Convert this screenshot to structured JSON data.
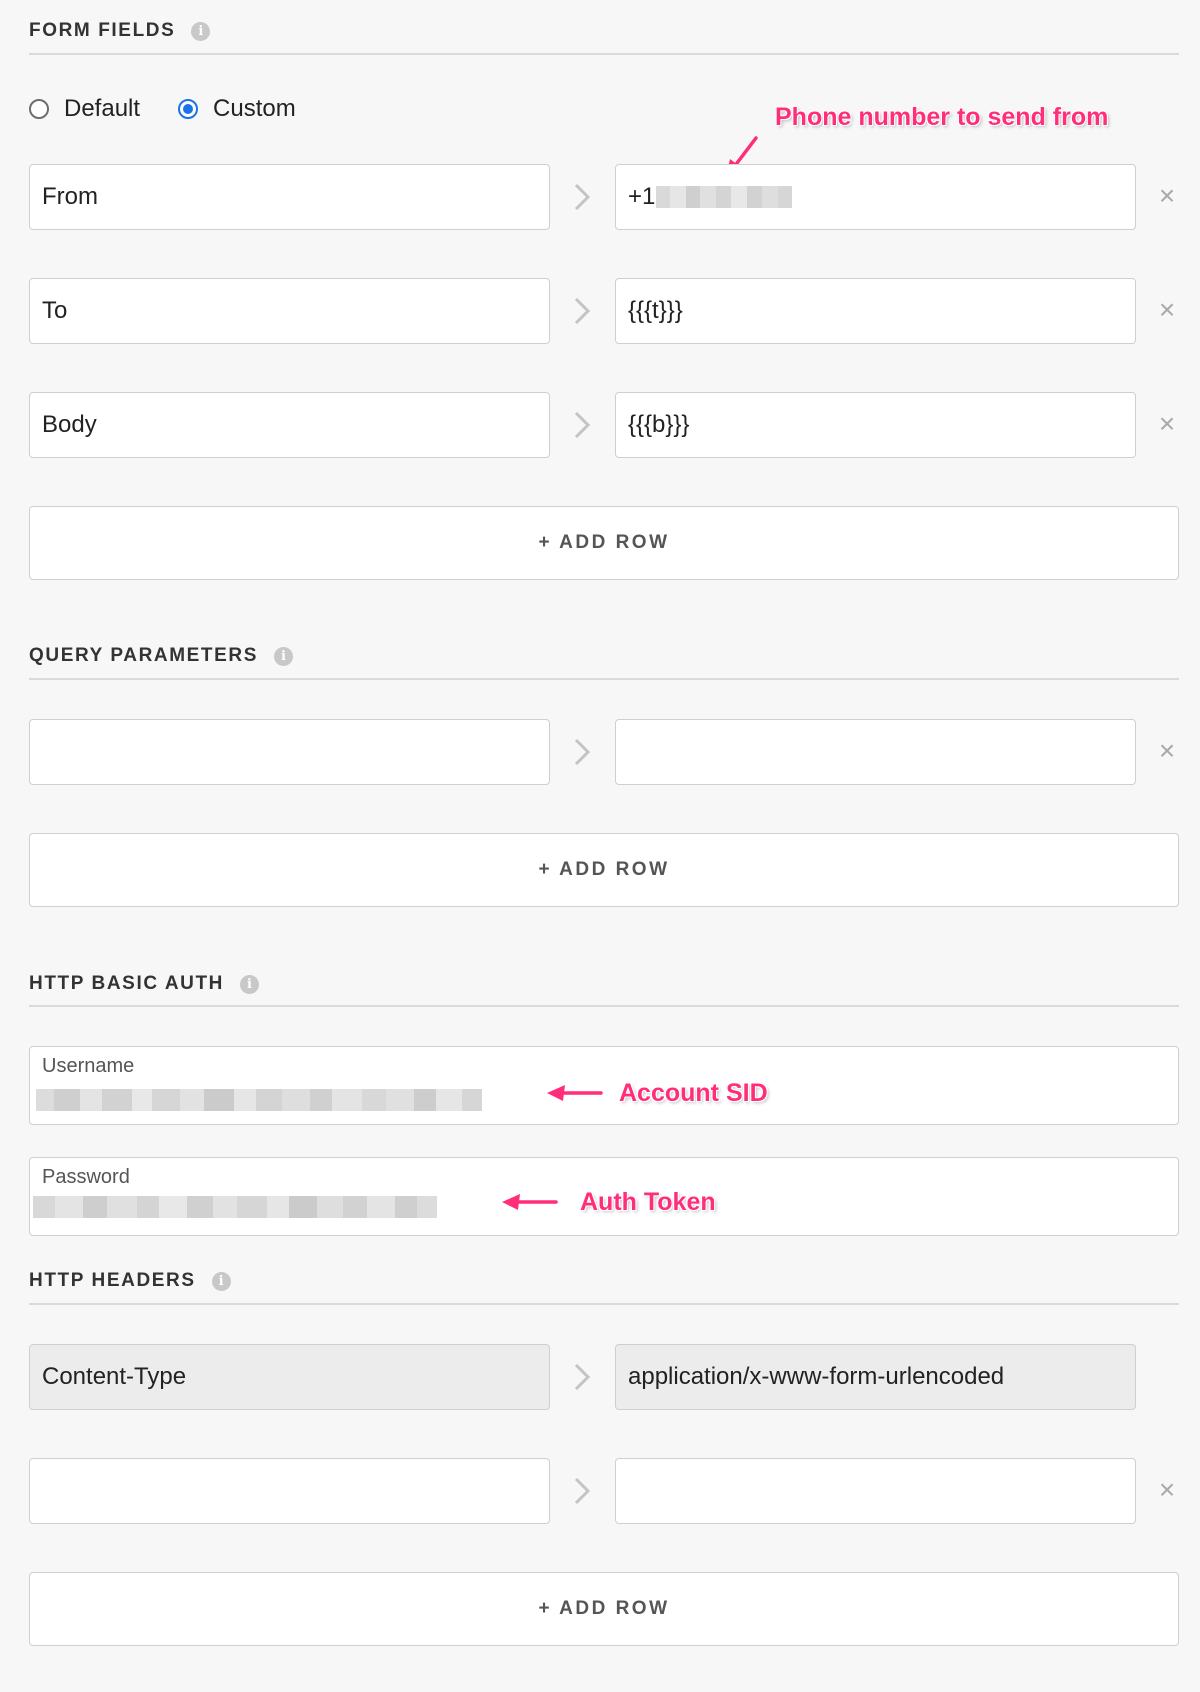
{
  "form_fields": {
    "heading": "FORM FIELDS",
    "info_icon": "info-icon",
    "radio_options": [
      {
        "label": "Default",
        "checked": false
      },
      {
        "label": "Custom",
        "checked": true
      }
    ],
    "rows": [
      {
        "key": "From",
        "value": "+1",
        "value_redacted": true
      },
      {
        "key": "To",
        "value": "{{{t}}}"
      },
      {
        "key": "Body",
        "value": "{{{b}}}"
      }
    ],
    "add_row_label": "+ ADD ROW"
  },
  "query_parameters": {
    "heading": "QUERY PARAMETERS",
    "rows": [
      {
        "key": "",
        "value": ""
      }
    ],
    "add_row_label": "+ ADD ROW"
  },
  "http_basic_auth": {
    "heading": "HTTP BASIC AUTH",
    "username_label": "Username",
    "password_label": "Password"
  },
  "http_headers": {
    "heading": "HTTP HEADERS",
    "rows": [
      {
        "key": "Content-Type",
        "value": "application/x-www-form-urlencoded",
        "readonly": true
      },
      {
        "key": "",
        "value": ""
      }
    ],
    "add_row_label": "+ ADD ROW"
  },
  "annotations": {
    "phone": "Phone number to send from",
    "account_sid": "Account SID",
    "auth_token": "Auth Token"
  },
  "icons": {
    "remove": "close-icon",
    "arrow": "chevron-right-icon",
    "info": "info-icon"
  },
  "colors": {
    "annotation": "#ff2d7a",
    "radio_checked": "#1a73e8",
    "background": "#f7f7f7"
  }
}
